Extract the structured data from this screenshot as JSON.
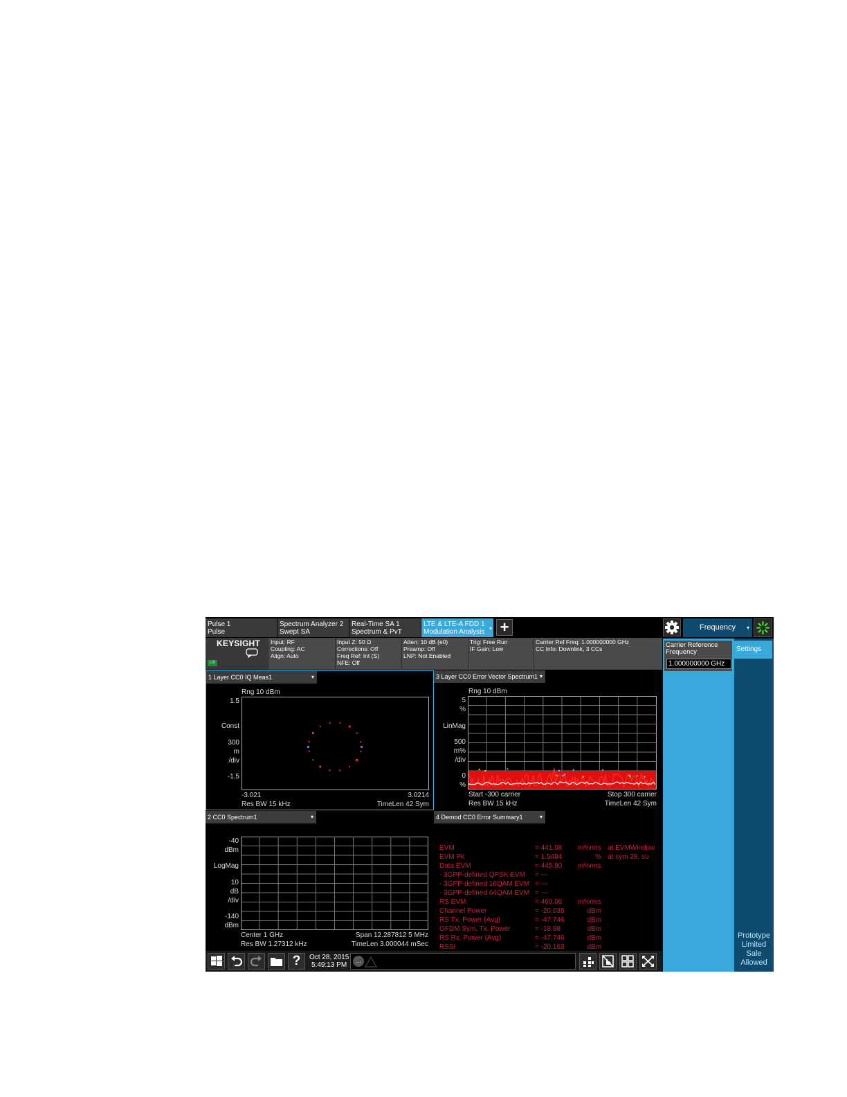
{
  "tabs": [
    {
      "line1": "Pulse 1",
      "line2": "Pulse"
    },
    {
      "line1": "Spectrum Analyzer 2",
      "line2": "Swept SA"
    },
    {
      "line1": "Real-Time SA 1",
      "line2": "Spectrum & PvT"
    },
    {
      "line1": "LTE & LTE-A FDD 1",
      "line2": "Modulation Analysis",
      "active": true
    }
  ],
  "icons": {
    "caret": "▾",
    "plus": "+",
    "msg": "…"
  },
  "top_right": {
    "menu_label": "Frequency"
  },
  "brand": {
    "logo": "KEYSIGHT",
    "lxi": "LXI"
  },
  "status": {
    "col1": [
      "Input: RF",
      "Coupling: AC",
      "Align: Auto"
    ],
    "col2": [
      "Input Z: 50 Ω",
      "Corrections: Off",
      "Freq Ref: Int (S)",
      "NFE: Off"
    ],
    "col3": [
      "Atten: 10 dB (e0)",
      "Preamp: Off",
      "LNP: Not Enabled"
    ],
    "col4": [
      "Trig: Free Run",
      "IF Gain: Low"
    ],
    "col5": [
      "Carrier Ref Freq: 1.000000000 GHz",
      "CC Info: Downlink, 3 CCs"
    ]
  },
  "panel1": {
    "title": "1 Layer CC0 IQ Meas1",
    "rng": "Rng 10 dBm",
    "y_top": "1.5",
    "y_bottom": "-1.5",
    "scale": [
      "Const",
      "300",
      "m",
      "/div"
    ],
    "x_left": "-3.021",
    "x_right": "3.0214",
    "footer_left": "Res BW 15 kHz",
    "footer_right": "TimeLen 42  Sym"
  },
  "panel3": {
    "title": "3 Layer CC0 Error Vector Spectrum1",
    "rng": "Rng 10 dBm",
    "y_top": "5",
    "y_top_unit": "%",
    "scale": [
      "LinMag",
      "500",
      "m%",
      "/div"
    ],
    "y_bottom": "0",
    "y_bottom_unit": "%",
    "start": "Start -300  carrier",
    "stop": "Stop 300  carrier",
    "footer_left": "Res BW 15 kHz",
    "footer_right": "TimeLen 42  Sym"
  },
  "panel2": {
    "title": "2 CC0 Spectrum1",
    "y_top": "-40",
    "y_top_unit": "dBm",
    "scale": [
      "LogMag",
      "10",
      "dB",
      "/div"
    ],
    "y_bottom": "-140",
    "y_bottom_unit": "dBm",
    "center": "Center 1 GHz",
    "span": "Span 12.287812 5 MHz",
    "footer_left": "Res BW 1.27312 kHz",
    "footer_right": "TimeLen 3.000044 mSec"
  },
  "panel4": {
    "title": "4 Demod CC0 Error Summary1",
    "rows": [
      {
        "name": "EVM",
        "value": "= 441.08",
        "unit": "m%rms",
        "extra": "at  EVMWindow"
      },
      {
        "name": "EVM Pk",
        "value": "= 1.5484",
        "unit": "%",
        "extra": "at  sym 28,  su"
      },
      {
        "name": "Data EVM",
        "value": "= 445.80",
        "unit": "m%rms",
        "extra": ""
      },
      {
        "name": "- 3GPP-defined QPSK EVM",
        "value": "= ---",
        "unit": "",
        "extra": ""
      },
      {
        "name": "- 3GPP-defined 16QAM EVM",
        "value": "= ---",
        "unit": "",
        "extra": ""
      },
      {
        "name": "- 3GPP-defined 64QAM EVM",
        "value": "= ---",
        "unit": "",
        "extra": ""
      },
      {
        "name": "RS EVM",
        "value": "= 460.06",
        "unit": "m%rms",
        "extra": ""
      },
      {
        "name": "Channel Power",
        "value": "= -20.035",
        "unit": "dBm",
        "extra": ""
      },
      {
        "name": "RS Tx. Power (Avg)",
        "value": "= -47.746",
        "unit": "dBm",
        "extra": ""
      },
      {
        "name": "OFDM Sym. Tx. Power",
        "value": "= -18.98",
        "unit": "dBm",
        "extra": ""
      },
      {
        "name": "RS Rx. Power (Avg)",
        "value": "= -47.746",
        "unit": "dBm",
        "extra": ""
      },
      {
        "name": "RSSI",
        "value": "= -20.163",
        "unit": "dBm",
        "extra": ""
      }
    ]
  },
  "bottom": {
    "date": "Oct 28, 2015",
    "time": "5:49:13 PM"
  },
  "right_panel": {
    "label": "Carrier Reference Frequency",
    "value": "1.000000000 GHz",
    "tab": "Settings",
    "watermark": [
      "Prototype",
      "Limited",
      "Sale",
      "Allowed"
    ]
  },
  "colors": {
    "accent": "#39a9dc",
    "dark_accent": "#0e4b6e",
    "trace_green": "#33ff1a",
    "summary_red": "#d41a3b",
    "evs_red": "#e01010",
    "const_magenta": "#e0207a"
  }
}
